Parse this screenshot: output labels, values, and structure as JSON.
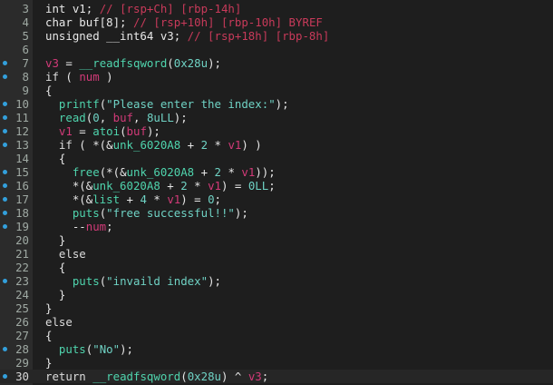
{
  "editor": {
    "lines": [
      {
        "num": "3",
        "bp": false,
        "parts": [
          [
            "t",
            "int v1; "
          ],
          [
            "c",
            "// [rsp+Ch] [rbp-14h]"
          ]
        ]
      },
      {
        "num": "4",
        "bp": false,
        "parts": [
          [
            "t",
            "char buf[8]; "
          ],
          [
            "c",
            "// [rsp+10h] [rbp-10h] BYREF"
          ]
        ]
      },
      {
        "num": "5",
        "bp": false,
        "parts": [
          [
            "t",
            "unsigned __int64 v3; "
          ],
          [
            "c",
            "// [rsp+18h] [rbp-8h]"
          ]
        ]
      },
      {
        "num": "6",
        "bp": false,
        "parts": []
      },
      {
        "num": "7",
        "bp": true,
        "parts": [
          [
            "v",
            "v3"
          ],
          [
            "p",
            " = "
          ],
          [
            "f",
            "__readfsqword"
          ],
          [
            "p",
            "("
          ],
          [
            "n",
            "0x28u"
          ],
          [
            "p",
            ");"
          ]
        ]
      },
      {
        "num": "8",
        "bp": true,
        "parts": [
          [
            "k",
            "if"
          ],
          [
            "p",
            " ( "
          ],
          [
            "v",
            "num"
          ],
          [
            "p",
            " )"
          ]
        ]
      },
      {
        "num": "9",
        "bp": false,
        "parts": [
          [
            "p",
            "{"
          ]
        ]
      },
      {
        "num": "10",
        "bp": true,
        "parts": [
          [
            "p",
            "  "
          ],
          [
            "f",
            "printf"
          ],
          [
            "p",
            "("
          ],
          [
            "s",
            "\"Please enter the index:\""
          ],
          [
            "p",
            ");"
          ]
        ]
      },
      {
        "num": "11",
        "bp": true,
        "parts": [
          [
            "p",
            "  "
          ],
          [
            "f",
            "read"
          ],
          [
            "p",
            "("
          ],
          [
            "n",
            "0"
          ],
          [
            "p",
            ", "
          ],
          [
            "v",
            "buf"
          ],
          [
            "p",
            ", "
          ],
          [
            "n",
            "8uLL"
          ],
          [
            "p",
            ");"
          ]
        ]
      },
      {
        "num": "12",
        "bp": true,
        "parts": [
          [
            "p",
            "  "
          ],
          [
            "v",
            "v1"
          ],
          [
            "p",
            " = "
          ],
          [
            "f",
            "atoi"
          ],
          [
            "p",
            "("
          ],
          [
            "v",
            "buf"
          ],
          [
            "p",
            ");"
          ]
        ]
      },
      {
        "num": "13",
        "bp": true,
        "parts": [
          [
            "p",
            "  "
          ],
          [
            "k",
            "if"
          ],
          [
            "p",
            " ( *(&"
          ],
          [
            "g",
            "unk_6020A8"
          ],
          [
            "p",
            " + "
          ],
          [
            "n",
            "2"
          ],
          [
            "p",
            " * "
          ],
          [
            "v",
            "v1"
          ],
          [
            "p",
            ") )"
          ]
        ]
      },
      {
        "num": "14",
        "bp": false,
        "parts": [
          [
            "p",
            "  {"
          ]
        ]
      },
      {
        "num": "15",
        "bp": true,
        "parts": [
          [
            "p",
            "    "
          ],
          [
            "f",
            "free"
          ],
          [
            "p",
            "(*(&"
          ],
          [
            "g",
            "unk_6020A8"
          ],
          [
            "p",
            " + "
          ],
          [
            "n",
            "2"
          ],
          [
            "p",
            " * "
          ],
          [
            "v",
            "v1"
          ],
          [
            "p",
            "));"
          ]
        ]
      },
      {
        "num": "16",
        "bp": true,
        "parts": [
          [
            "p",
            "    *(&"
          ],
          [
            "g",
            "unk_6020A8"
          ],
          [
            "p",
            " + "
          ],
          [
            "n",
            "2"
          ],
          [
            "p",
            " * "
          ],
          [
            "v",
            "v1"
          ],
          [
            "p",
            ") = "
          ],
          [
            "n",
            "0LL"
          ],
          [
            "p",
            ";"
          ]
        ]
      },
      {
        "num": "17",
        "bp": true,
        "parts": [
          [
            "p",
            "    *(&"
          ],
          [
            "g",
            "list"
          ],
          [
            "p",
            " + "
          ],
          [
            "n",
            "4"
          ],
          [
            "p",
            " * "
          ],
          [
            "v",
            "v1"
          ],
          [
            "p",
            ") = "
          ],
          [
            "n",
            "0"
          ],
          [
            "p",
            ";"
          ]
        ]
      },
      {
        "num": "18",
        "bp": true,
        "parts": [
          [
            "p",
            "    "
          ],
          [
            "f",
            "puts"
          ],
          [
            "p",
            "("
          ],
          [
            "s",
            "\"free successful!!\""
          ],
          [
            "p",
            ");"
          ]
        ]
      },
      {
        "num": "19",
        "bp": true,
        "parts": [
          [
            "p",
            "    --"
          ],
          [
            "v",
            "num"
          ],
          [
            "p",
            ";"
          ]
        ]
      },
      {
        "num": "20",
        "bp": false,
        "parts": [
          [
            "p",
            "  }"
          ]
        ]
      },
      {
        "num": "21",
        "bp": false,
        "parts": [
          [
            "p",
            "  "
          ],
          [
            "k",
            "else"
          ]
        ]
      },
      {
        "num": "22",
        "bp": false,
        "parts": [
          [
            "p",
            "  {"
          ]
        ]
      },
      {
        "num": "23",
        "bp": true,
        "parts": [
          [
            "p",
            "    "
          ],
          [
            "f",
            "puts"
          ],
          [
            "p",
            "("
          ],
          [
            "s",
            "\"invaild index\""
          ],
          [
            "p",
            ");"
          ]
        ]
      },
      {
        "num": "24",
        "bp": false,
        "parts": [
          [
            "p",
            "  }"
          ]
        ]
      },
      {
        "num": "25",
        "bp": false,
        "parts": [
          [
            "p",
            "}"
          ]
        ]
      },
      {
        "num": "26",
        "bp": false,
        "parts": [
          [
            "k",
            "else"
          ]
        ]
      },
      {
        "num": "27",
        "bp": false,
        "parts": [
          [
            "p",
            "{"
          ]
        ]
      },
      {
        "num": "28",
        "bp": true,
        "parts": [
          [
            "p",
            "  "
          ],
          [
            "f",
            "puts"
          ],
          [
            "p",
            "("
          ],
          [
            "s",
            "\"No\""
          ],
          [
            "p",
            ");"
          ]
        ]
      },
      {
        "num": "29",
        "bp": false,
        "parts": [
          [
            "p",
            "}"
          ]
        ]
      },
      {
        "num": "30",
        "bp": true,
        "current": true,
        "parts": [
          [
            "k",
            "return"
          ],
          [
            "p",
            " "
          ],
          [
            "f",
            "__readfsqword"
          ],
          [
            "p",
            "("
          ],
          [
            "n",
            "0x28u"
          ],
          [
            "p",
            ") ^ "
          ],
          [
            "v",
            "v3"
          ],
          [
            "p",
            ";"
          ]
        ]
      }
    ]
  }
}
